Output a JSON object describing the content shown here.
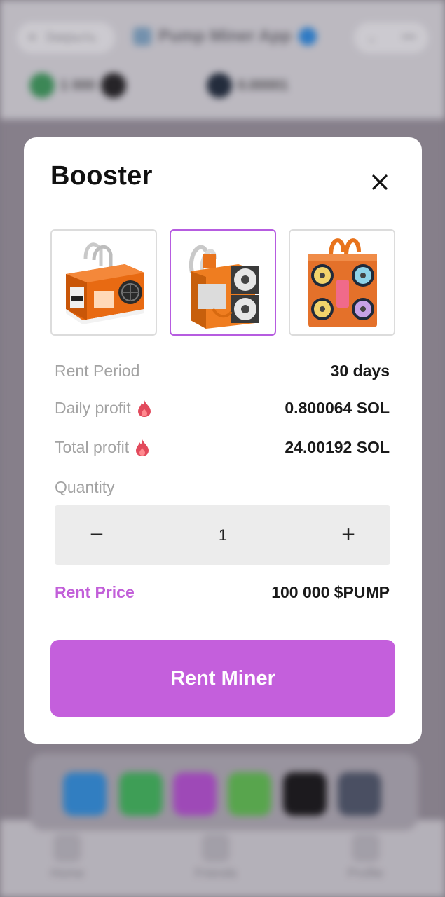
{
  "background": {
    "close_label": "Закрыть",
    "app_title": "Pump Miner App",
    "balance_1": "1 000",
    "balance_2": "0.00001",
    "nav": [
      "Home",
      "Friends",
      "Profile"
    ]
  },
  "modal": {
    "title": "Booster",
    "close_icon": "close-icon",
    "products": [
      {
        "name": "miner-evga-orange",
        "selected": false
      },
      {
        "name": "miner-dual-fan-orange",
        "selected": true
      },
      {
        "name": "miner-quad-fan-orange",
        "selected": false
      }
    ],
    "rent_period_label": "Rent Period",
    "rent_period_value": "30 days",
    "daily_profit_label": "Daily profit",
    "daily_profit_value": "0.800064 SOL",
    "total_profit_label": "Total profit",
    "total_profit_value": "24.00192 SOL",
    "quantity_label": "Quantity",
    "quantity_value": "1",
    "minus_symbol": "−",
    "plus_symbol": "+",
    "rent_price_label": "Rent Price",
    "rent_price_value": "100 000 $PUMP",
    "rent_button": "Rent Miner"
  },
  "colors": {
    "accent": "#c45fdc",
    "accent_text": "#c25fd9",
    "selected_border": "#b65ce0",
    "flame": "#e24a5c"
  }
}
